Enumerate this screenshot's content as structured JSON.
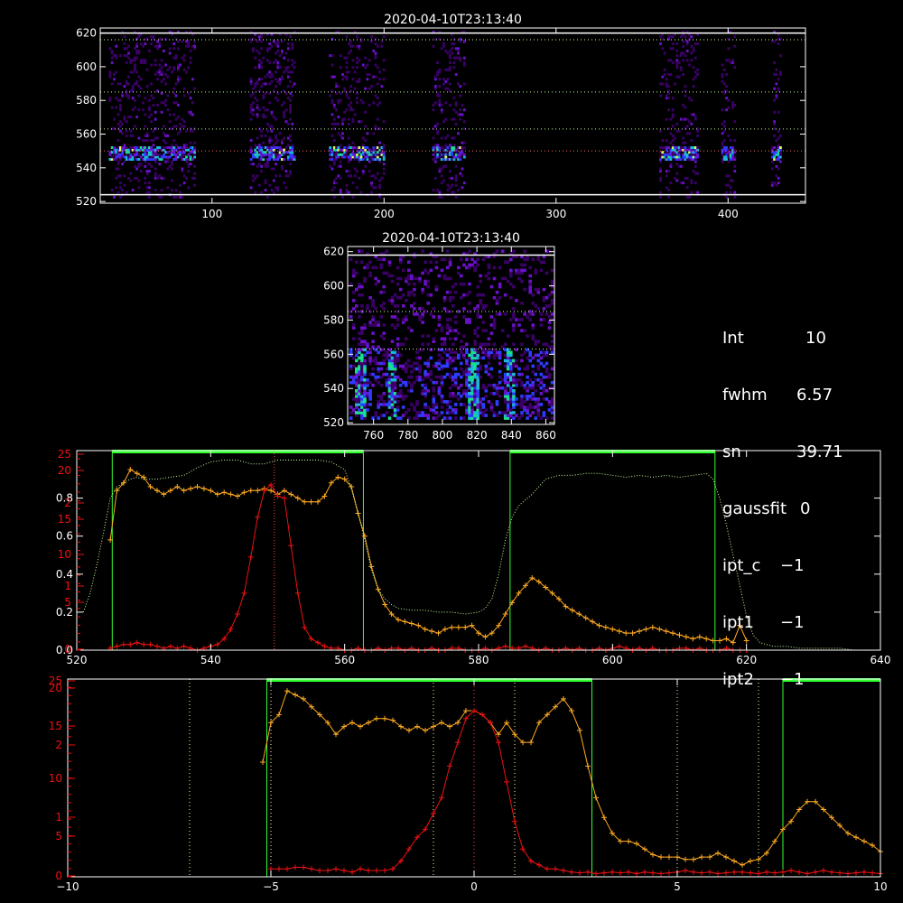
{
  "chart_data": [
    {
      "type": "heatmap",
      "title": "2020-04-10T23:13:40",
      "xlim": [
        35,
        445
      ],
      "ylim": [
        519,
        623
      ],
      "xticks": [
        100,
        200,
        300,
        400
      ],
      "yticks": [
        520,
        540,
        560,
        580,
        600,
        620
      ],
      "bands_x": [
        [
          40,
          90
        ],
        [
          122,
          148
        ],
        [
          168,
          200
        ],
        [
          228,
          246
        ],
        [
          360,
          382
        ],
        [
          396,
          404
        ],
        [
          425,
          430
        ]
      ],
      "core_y": [
        543,
        552
      ],
      "hlines_y": [
        524,
        550,
        563,
        585,
        616,
        620
      ],
      "colormap": [
        "#3a0066",
        "#6a11c8",
        "#2d3bff",
        "#19b8d6",
        "#19e08a",
        "#d8ff5a"
      ]
    },
    {
      "type": "heatmap",
      "title": "2020-04-10T23:13:40",
      "xlim": [
        745,
        865
      ],
      "ylim": [
        519,
        623
      ],
      "xticks": [
        760,
        780,
        800,
        820,
        840,
        860
      ],
      "yticks": [
        520,
        540,
        560,
        580,
        600,
        620
      ],
      "bright_columns_x": [
        752,
        770,
        817,
        838
      ],
      "hlines_y": [
        563,
        585,
        618
      ]
    },
    {
      "type": "line",
      "xlim": [
        520,
        640
      ],
      "ylim": [
        0,
        1.05
      ],
      "xticks": [
        520,
        540,
        560,
        580,
        600,
        620,
        640
      ],
      "yticks_left": [
        "0.0",
        "0.2",
        "0.4",
        "0.6",
        "0.8"
      ],
      "yticks_red": [
        "0",
        "5",
        "1",
        "10",
        "15",
        "2",
        "20",
        "25"
      ],
      "band_regions": [
        [
          525.3,
          562.8
        ],
        [
          584.7,
          615.3
        ]
      ],
      "center_line_x": 549.5,
      "series": [
        {
          "color": "#ffaa22",
          "x": [
            525,
            526,
            527,
            528,
            529,
            530,
            531,
            532,
            533,
            534,
            535,
            536,
            537,
            538,
            539,
            540,
            541,
            542,
            543,
            544,
            545,
            546,
            547,
            548,
            549,
            550,
            551,
            552,
            553,
            554,
            555,
            556,
            557,
            558,
            559,
            560,
            561,
            562,
            563,
            564,
            565,
            566,
            567,
            568,
            569,
            570,
            571,
            572,
            573,
            574,
            575,
            576,
            577,
            578,
            579,
            580,
            581,
            582,
            583,
            584,
            585,
            586,
            587,
            588,
            589,
            590,
            591,
            592,
            593,
            594,
            595,
            596,
            597,
            598,
            599,
            600,
            601,
            602,
            603,
            604,
            605,
            606,
            607,
            608,
            609,
            610,
            611,
            612,
            613,
            614,
            615,
            616,
            617,
            618,
            619,
            620
          ],
          "y": [
            0.58,
            0.84,
            0.88,
            0.95,
            0.93,
            0.91,
            0.86,
            0.84,
            0.82,
            0.84,
            0.86,
            0.84,
            0.85,
            0.86,
            0.85,
            0.84,
            0.82,
            0.83,
            0.82,
            0.81,
            0.83,
            0.84,
            0.84,
            0.85,
            0.84,
            0.82,
            0.84,
            0.82,
            0.8,
            0.78,
            0.78,
            0.78,
            0.81,
            0.88,
            0.91,
            0.9,
            0.86,
            0.72,
            0.6,
            0.44,
            0.32,
            0.24,
            0.19,
            0.16,
            0.15,
            0.14,
            0.13,
            0.11,
            0.1,
            0.09,
            0.11,
            0.12,
            0.12,
            0.12,
            0.13,
            0.09,
            0.07,
            0.09,
            0.13,
            0.19,
            0.25,
            0.3,
            0.34,
            0.38,
            0.36,
            0.33,
            0.3,
            0.27,
            0.23,
            0.21,
            0.19,
            0.17,
            0.15,
            0.13,
            0.12,
            0.11,
            0.1,
            0.09,
            0.09,
            0.1,
            0.11,
            0.12,
            0.11,
            0.1,
            0.09,
            0.08,
            0.07,
            0.06,
            0.07,
            0.06,
            0.05,
            0.05,
            0.06,
            0.04,
            0.13,
            0.05
          ]
        },
        {
          "color": "#ee1111",
          "x": [
            525,
            526,
            527,
            528,
            529,
            530,
            531,
            532,
            533,
            534,
            535,
            536,
            537,
            538,
            539,
            540,
            541,
            542,
            543,
            544,
            545,
            546,
            547,
            548,
            549,
            550,
            551,
            552,
            553,
            554,
            555,
            556,
            557,
            558,
            559,
            560,
            561,
            562,
            563,
            564,
            565,
            566,
            567,
            568,
            569,
            570,
            571,
            572,
            573,
            574,
            575,
            576,
            577,
            578,
            579,
            580,
            581,
            582,
            583,
            584,
            585,
            586,
            587,
            588,
            589,
            590,
            591,
            592,
            593,
            594,
            595,
            596,
            597,
            598,
            599,
            600,
            601,
            602,
            603,
            604,
            605,
            606,
            607,
            608,
            609,
            610,
            611,
            612,
            613,
            614,
            615,
            616,
            617,
            618,
            619,
            620
          ],
          "y": [
            0.01,
            0.02,
            0.03,
            0.03,
            0.04,
            0.03,
            0.03,
            0.02,
            0.01,
            0.02,
            0.01,
            0.02,
            0.01,
            0.0,
            0.01,
            0.02,
            0.03,
            0.06,
            0.11,
            0.19,
            0.3,
            0.49,
            0.7,
            0.84,
            0.87,
            0.81,
            0.8,
            0.55,
            0.3,
            0.12,
            0.06,
            0.04,
            0.02,
            0.01,
            0.01,
            0.0,
            0.0,
            0.01,
            0.0,
            0.0,
            0.01,
            0.0,
            0.01,
            0.01,
            0.0,
            0.01,
            0.0,
            0.0,
            0.01,
            0.0,
            0.0,
            0.01,
            0.01,
            0.0,
            0.0,
            0.0,
            0.01,
            0.0,
            0.01,
            0.02,
            0.01,
            0.01,
            0.02,
            0.01,
            0.0,
            0.01,
            0.0,
            0.0,
            0.01,
            0.0,
            0.01,
            0.0,
            0.0,
            0.01,
            0.0,
            0.01,
            0.02,
            0.01,
            0.0,
            0.01,
            0.0,
            0.01,
            0.0,
            0.0,
            0.0,
            0.01,
            0.01,
            0.0,
            0.01,
            0.0,
            0.0,
            0.0,
            0.01,
            0.0,
            0.0,
            0.0
          ]
        },
        {
          "color": "#ccff99",
          "dashed": true,
          "x": [
            521,
            522,
            523,
            524,
            525,
            526,
            527,
            528,
            529,
            530,
            532,
            534,
            536,
            538,
            540,
            542,
            544,
            546,
            548,
            550,
            552,
            554,
            556,
            558,
            560,
            561,
            562,
            563,
            564,
            565,
            566,
            567,
            568,
            570,
            572,
            574,
            576,
            578,
            580,
            581,
            582,
            583,
            584,
            585,
            586,
            588,
            590,
            592,
            594,
            596,
            598,
            600,
            602,
            604,
            606,
            608,
            610,
            612,
            614,
            615,
            616,
            617,
            618,
            619,
            620,
            621,
            622,
            624,
            626,
            628,
            630,
            632,
            634,
            636,
            638,
            640
          ],
          "y": [
            0.2,
            0.3,
            0.45,
            0.62,
            0.8,
            0.86,
            0.88,
            0.9,
            0.91,
            0.9,
            0.9,
            0.91,
            0.92,
            0.96,
            0.99,
            1.0,
            1.0,
            0.98,
            0.98,
            1.0,
            1.0,
            1.0,
            1.0,
            0.99,
            0.95,
            0.85,
            0.72,
            0.58,
            0.42,
            0.32,
            0.27,
            0.24,
            0.22,
            0.21,
            0.21,
            0.2,
            0.2,
            0.19,
            0.2,
            0.22,
            0.27,
            0.4,
            0.58,
            0.7,
            0.76,
            0.82,
            0.9,
            0.92,
            0.92,
            0.93,
            0.93,
            0.92,
            0.91,
            0.92,
            0.91,
            0.92,
            0.91,
            0.92,
            0.93,
            0.9,
            0.8,
            0.66,
            0.5,
            0.34,
            0.18,
            0.08,
            0.04,
            0.02,
            0.02,
            0.01,
            0.01,
            0.01,
            0.01,
            0.0,
            0.0,
            0.0
          ]
        }
      ]
    },
    {
      "type": "line",
      "xlim": [
        -10,
        10
      ],
      "ylim": [
        0,
        25
      ],
      "xticks": [
        -10,
        -5,
        0,
        5,
        10
      ],
      "yticks_red": [
        "0",
        "5",
        "1",
        "10",
        "15",
        "2",
        "20",
        "25"
      ],
      "band_regions": [
        [
          -5.1,
          2.9
        ],
        [
          7.6,
          10
        ]
      ],
      "vlines_x": [
        -7,
        -5,
        -1,
        0,
        1,
        5,
        7
      ],
      "series": [
        {
          "color": "#ffaa22",
          "x": [
            -5.2,
            -5.0,
            -4.8,
            -4.6,
            -4.4,
            -4.2,
            -4.0,
            -3.8,
            -3.6,
            -3.4,
            -3.2,
            -3.0,
            -2.8,
            -2.6,
            -2.4,
            -2.2,
            -2.0,
            -1.8,
            -1.6,
            -1.4,
            -1.2,
            -1.0,
            -0.8,
            -0.6,
            -0.4,
            -0.2,
            0.0,
            0.2,
            0.4,
            0.6,
            0.8,
            1.0,
            1.2,
            1.4,
            1.6,
            1.8,
            2.0,
            2.2,
            2.4,
            2.6,
            2.8,
            3.0,
            3.2,
            3.4,
            3.6,
            3.8,
            4.0,
            4.2,
            4.4,
            4.6,
            4.8,
            5.0,
            5.2,
            5.4,
            5.6,
            5.8,
            6.0,
            6.2,
            6.4,
            6.6,
            6.8,
            7.0,
            7.2,
            7.4,
            7.6,
            7.8,
            8.0,
            8.2,
            8.4,
            8.6,
            8.8,
            9.0,
            9.2,
            9.4,
            9.6,
            9.8,
            10.0
          ],
          "y": [
            14.5,
            19.5,
            20.5,
            23.5,
            23.0,
            22.5,
            21.5,
            20.5,
            19.5,
            18.0,
            19.0,
            19.5,
            19.0,
            19.5,
            20.0,
            20.0,
            19.8,
            19.0,
            18.5,
            19.0,
            18.5,
            19.0,
            19.5,
            19.0,
            19.5,
            21.0,
            21.0,
            20.5,
            19.5,
            18.0,
            19.5,
            18.0,
            17.0,
            17.0,
            19.5,
            20.5,
            21.5,
            22.5,
            21.0,
            18.5,
            14.0,
            10.0,
            7.5,
            5.5,
            4.5,
            4.5,
            4.2,
            3.5,
            2.8,
            2.5,
            2.5,
            2.5,
            2.2,
            2.2,
            2.5,
            2.5,
            3.0,
            2.5,
            2.0,
            1.5,
            2.0,
            2.2,
            3.0,
            4.5,
            6.0,
            7.0,
            8.5,
            9.5,
            9.5,
            8.5,
            7.5,
            6.5,
            5.5,
            5.0,
            4.5,
            4.0,
            3.2
          ]
        },
        {
          "color": "#ee1111",
          "x": [
            -5.0,
            -4.8,
            -4.6,
            -4.4,
            -4.2,
            -4.0,
            -3.8,
            -3.6,
            -3.4,
            -3.2,
            -3.0,
            -2.8,
            -2.6,
            -2.4,
            -2.2,
            -2.0,
            -1.8,
            -1.6,
            -1.4,
            -1.2,
            -1.0,
            -0.8,
            -0.6,
            -0.4,
            -0.2,
            0.0,
            0.2,
            0.4,
            0.6,
            0.8,
            1.0,
            1.2,
            1.4,
            1.6,
            1.8,
            2.0,
            2.2,
            2.4,
            2.6,
            2.8,
            3.0,
            3.2,
            3.4,
            3.6,
            3.8,
            4.0,
            4.2,
            4.4,
            4.6,
            4.8,
            5.0,
            5.2,
            5.4,
            5.6,
            5.8,
            6.0,
            6.2,
            6.4,
            6.6,
            6.8,
            7.0,
            7.2,
            7.4,
            7.6,
            7.8,
            8.0,
            8.2,
            8.4,
            8.6,
            8.8,
            9.0,
            9.2,
            9.4,
            9.6,
            9.8,
            10.0
          ],
          "y": [
            1.0,
            1.0,
            1.0,
            1.2,
            1.2,
            1.0,
            0.8,
            0.8,
            1.0,
            0.8,
            0.6,
            1.0,
            0.8,
            0.8,
            0.8,
            1.0,
            2.0,
            3.5,
            5.0,
            6.0,
            8.0,
            10.0,
            14.0,
            17.0,
            20.0,
            21.0,
            20.5,
            19.5,
            17.0,
            12.0,
            7.0,
            3.5,
            2.0,
            1.5,
            1.0,
            1.0,
            0.8,
            0.6,
            0.5,
            0.6,
            0.4,
            0.5,
            0.6,
            0.5,
            0.6,
            0.4,
            0.6,
            0.5,
            0.4,
            0.5,
            0.6,
            0.8,
            0.6,
            0.5,
            0.6,
            0.4,
            0.5,
            0.6,
            0.6,
            0.5,
            0.4,
            0.6,
            0.5,
            0.6,
            0.8,
            0.6,
            0.4,
            0.6,
            0.8,
            0.6,
            0.5,
            0.4,
            0.5,
            0.6,
            0.5,
            0.4
          ]
        }
      ]
    }
  ],
  "info": {
    "int_label": "Int",
    "int_value": "10",
    "fwhm_label": "fwhm",
    "fwhm_value": "6.57",
    "sn_label": "sn",
    "sn_value": "39.71",
    "gaussfit_label": "gaussfit",
    "gaussfit_value": "0",
    "ipt_c_label": "ipt_c",
    "ipt_c_value": "−1",
    "ipt1_label": "ipt1",
    "ipt1_value": "−1",
    "ipt2_label": "ipt2",
    "ipt2_value": "−1"
  },
  "colors": {
    "orange": "#ffaa22",
    "red": "#ee1111",
    "green": "#33ff33",
    "green_dotted": "#ccff99",
    "axis": "#ffffff"
  }
}
